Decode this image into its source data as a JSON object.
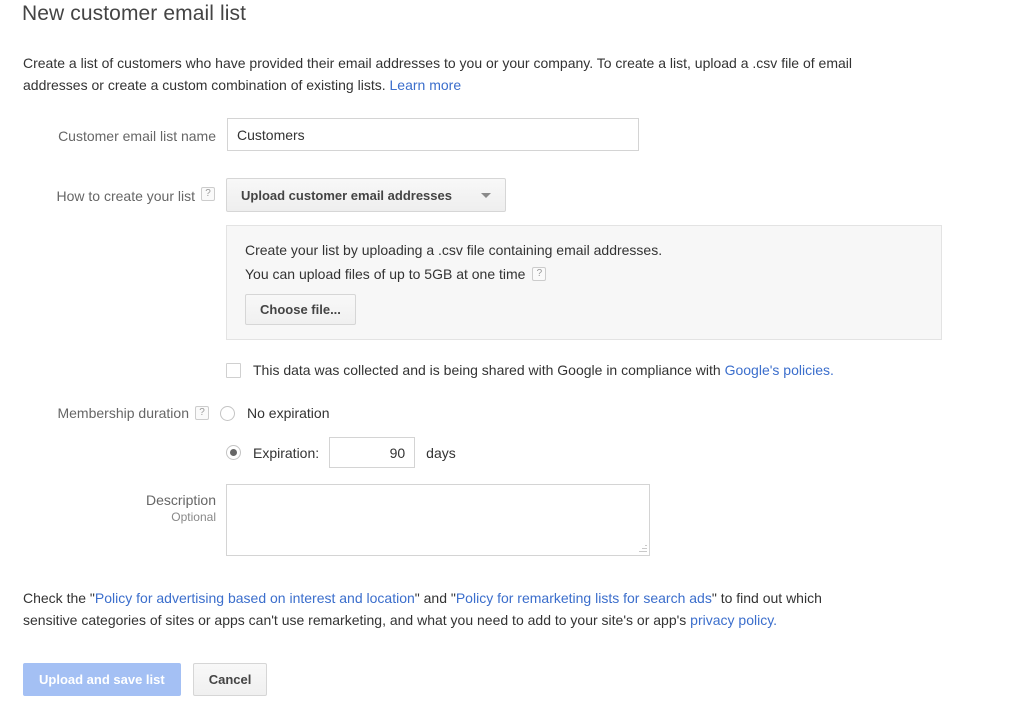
{
  "page": {
    "title": "New customer email list",
    "intro": {
      "text_before_link": "Create a list of customers who have provided their email addresses to you or your company. To create a list, upload a .csv file of email addresses or create a custom combination of existing lists. ",
      "link_label": "Learn more"
    }
  },
  "form": {
    "list_name": {
      "label": "Customer email list name",
      "value": "Customers",
      "placeholder": ""
    },
    "creation_method": {
      "label": "How to create your list",
      "help_icon": "help-question-icon",
      "help_glyph": "?",
      "selected_option": "Upload customer email addresses",
      "caret_icon": "chevron-down-icon"
    },
    "upload_panel": {
      "line1": "Create your list by uploading a .csv file containing email addresses.",
      "line2": "You can upload files of up to 5GB at one time",
      "help_icon": "help-question-icon",
      "help_glyph": "?",
      "choose_file_label": "Choose file..."
    },
    "compliance": {
      "checked": false,
      "checkbox_icon": "checkbox-unchecked-icon",
      "text": "This data was collected and is being shared with Google in compliance with ",
      "link_label": "Google's policies."
    },
    "membership_duration": {
      "label": "Membership duration",
      "help_icon": "help-question-icon",
      "help_glyph": "?",
      "options": [
        {
          "id": "no-expiration",
          "label": "No expiration",
          "selected": false
        },
        {
          "id": "expiration",
          "label": "Expiration:",
          "selected": true
        }
      ],
      "expiration_days_value": "90",
      "expiration_days_placeholder": "",
      "days_suffix": "days"
    },
    "description": {
      "label": "Description",
      "sub_label": "Optional",
      "value": "",
      "placeholder": ""
    }
  },
  "policy": {
    "part1": "Check the \"",
    "link1": "Policy for advertising based on interest and location",
    "part2": "\" and \"",
    "link2": "Policy for remarketing lists for search ads",
    "part3": "\" to find out which sensitive categories of sites or apps can't use remarketing, and what you need to add to your site's or app's ",
    "link3": "privacy policy.",
    "part4": ""
  },
  "footer": {
    "primary_label": "Upload and save list",
    "primary_disabled": true,
    "cancel_label": "Cancel"
  },
  "colors": {
    "link": "#3b6ecc",
    "primary_disabled_bg": "#a4c0f4",
    "panel_bg": "#f7f7f7",
    "text": "#333333",
    "label": "#666666"
  }
}
